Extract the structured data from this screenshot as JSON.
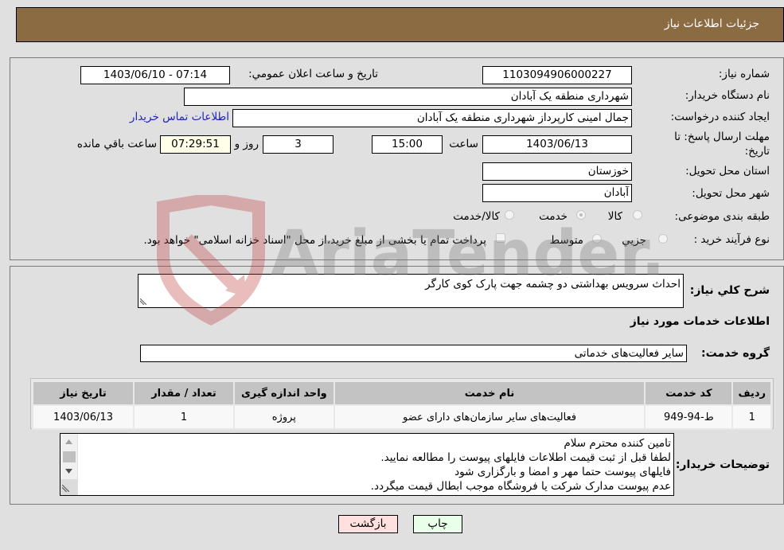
{
  "header": {
    "title": "جزئیات اطلاعات نیاز"
  },
  "form": {
    "need_number": {
      "label": "شماره نیاز:",
      "value": "1103094906000227"
    },
    "announce_datetime": {
      "label": "تاریخ و ساعت اعلان عمومي:",
      "value": "1403/06/10 - 07:14"
    },
    "buyer_org": {
      "label": "نام دستگاه خریدار:",
      "value": "شهرداری منطقه یک آبادان"
    },
    "requester": {
      "label": "ایجاد کننده درخواست:",
      "value": "جمال امینی کارپرداز شهرداری منطقه یک آبادان"
    },
    "buyer_contact_link": "اطلاعات تماس خریدار",
    "deadline": {
      "label_line1": "مهلت ارسال پاسخ: تا",
      "label_line2": "تاریخ:",
      "date": "1403/06/13",
      "time_label": "ساعت",
      "time": "15:00",
      "days": "3",
      "days_label": "روز و",
      "remaining": "07:29:51",
      "remaining_label": "ساعت باقي مانده"
    },
    "province": {
      "label": "استان محل تحویل:",
      "value": "خوزستان"
    },
    "city": {
      "label": "شهر محل تحویل:",
      "value": "آبادان"
    },
    "category": {
      "label": "طبقه بندی موضوعی:",
      "options": [
        "کالا",
        "خدمت",
        "کالا/خدمت"
      ],
      "selected": "خدمت"
    },
    "purchase_type": {
      "label": "نوع فرآیند خرید :",
      "options": [
        "جزیي",
        "متوسط"
      ],
      "treasury_note": "پرداخت تمام یا بخشی از مبلغ خرید،از محل \"اسناد خزانه اسلامی\" خواهد بود."
    }
  },
  "details": {
    "general_desc_label": "شرح کلي نیاز:",
    "general_desc": "احداث سرویس بهداشتی دو چشمه جهت پارک کوی کارگر",
    "services_heading": "اطلاعات خدمات مورد نیاز",
    "service_group_label": "گروه خدمت:",
    "service_group": "سایر فعالیت‌های خدماتی",
    "table": {
      "headers": [
        "ردیف",
        "کد خدمت",
        "نام خدمت",
        "واحد اندازه گیری",
        "تعداد / مقدار",
        "تاریخ نیاز"
      ],
      "rows": [
        [
          "1",
          "ط-94-949",
          "فعالیت‌های سایر سازمان‌های دارای عضو",
          "پروژه",
          "1",
          "1403/06/13"
        ]
      ]
    },
    "buyer_notes_label": "توضیحات خریدار:",
    "buyer_notes": [
      "تامین کننده محترم سلام",
      "لطفا قبل از ثبت قیمت اطلاعات فایلهای پیوست را مطالعه نمایید.",
      "فایلهای پیوست حتما مهر و امضا و بارگزاری شود",
      "عدم پیوست مدارک شرکت یا فروشگاه موجب ابطال قیمت میگردد."
    ]
  },
  "buttons": {
    "print": "چاپ",
    "back": "بازگشت"
  },
  "watermark": {
    "text": "AriaTender.neT"
  },
  "colors": {
    "header_bg": "#8b6c42",
    "print_bg": "#eaffea",
    "back_bg": "#ffe0e0",
    "link": "#2020c0"
  }
}
